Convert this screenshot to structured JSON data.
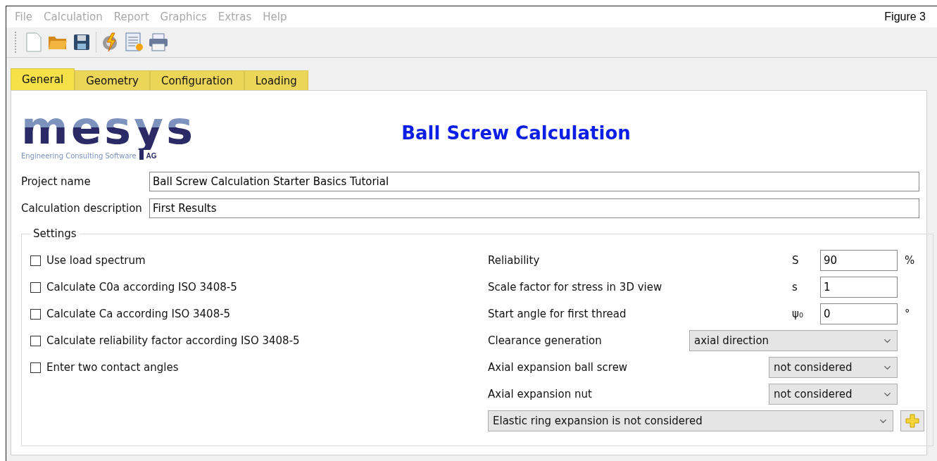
{
  "menu": [
    {
      "label": "File",
      "disabled": true
    },
    {
      "label": "Calculation",
      "disabled": true
    },
    {
      "label": "Report",
      "disabled": true
    },
    {
      "label": "Graphics",
      "disabled": true
    },
    {
      "label": "Extras",
      "disabled": true
    },
    {
      "label": "Help",
      "disabled": true
    }
  ],
  "caption": "Figure 3",
  "toolbar": [
    {
      "kind": "new"
    },
    {
      "kind": "open"
    },
    {
      "kind": "save"
    },
    {
      "kind": "separator"
    },
    {
      "kind": "calculate"
    },
    {
      "kind": "report"
    },
    {
      "kind": "print"
    }
  ],
  "tabs": [
    {
      "label": "General",
      "selected": true
    },
    {
      "label": "Geometry",
      "selected": false
    },
    {
      "label": "Configuration",
      "selected": false
    },
    {
      "label": "Loading",
      "selected": false
    }
  ],
  "logo": {
    "word": "mesys",
    "tagline": "Engineering Consulting Software",
    "suffix": "AG"
  },
  "title": "Ball Screw Calculation",
  "fields": [
    {
      "label": "Project name",
      "value": "Ball Screw Calculation Starter Basics Tutorial"
    },
    {
      "label": "Calculation description",
      "value": "First Results"
    }
  ],
  "settings": {
    "title": "Settings",
    "checkboxes": [
      {
        "label": "Use load spectrum",
        "checked": false
      },
      {
        "label": "Calculate C0a according ISO 3408-5",
        "checked": false
      },
      {
        "label": "Calculate Ca according ISO 3408-5",
        "checked": false
      },
      {
        "label": "Calculate reliability factor according ISO 3408-5",
        "checked": false
      },
      {
        "label": "Enter two contact angles",
        "checked": false
      }
    ],
    "rows": [
      {
        "kind": "input",
        "label": "Reliability",
        "symbol": "S",
        "value": "90",
        "unit": "%"
      },
      {
        "kind": "input",
        "label": "Scale factor for stress in 3D view",
        "symbol": "s",
        "value": "1"
      },
      {
        "kind": "input",
        "label": "Start angle for first thread",
        "symbol": "ψ₀",
        "value": "0",
        "unit": "°"
      },
      {
        "kind": "select",
        "label": "Clearance generation",
        "value": "axial direction",
        "wide": true
      },
      {
        "kind": "select",
        "label": "Axial expansion ball screw",
        "value": "not considered",
        "wide": false
      },
      {
        "kind": "select",
        "label": "Axial expansion nut",
        "value": "not considered",
        "wide": false
      },
      {
        "kind": "fullselect",
        "value": "Elastic ring expansion is not considered"
      }
    ]
  }
}
